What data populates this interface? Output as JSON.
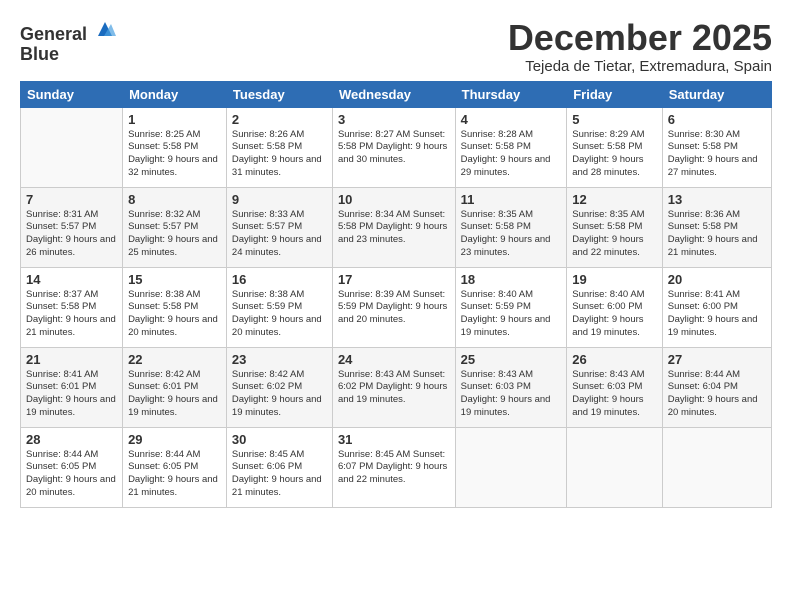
{
  "logo": {
    "line1": "General",
    "line2": "Blue"
  },
  "title": "December 2025",
  "location": "Tejeda de Tietar, Extremadura, Spain",
  "days_header": [
    "Sunday",
    "Monday",
    "Tuesday",
    "Wednesday",
    "Thursday",
    "Friday",
    "Saturday"
  ],
  "weeks": [
    [
      {
        "day": "",
        "info": ""
      },
      {
        "day": "1",
        "info": "Sunrise: 8:25 AM\nSunset: 5:58 PM\nDaylight: 9 hours\nand 32 minutes."
      },
      {
        "day": "2",
        "info": "Sunrise: 8:26 AM\nSunset: 5:58 PM\nDaylight: 9 hours\nand 31 minutes."
      },
      {
        "day": "3",
        "info": "Sunrise: 8:27 AM\nSunset: 5:58 PM\nDaylight: 9 hours\nand 30 minutes."
      },
      {
        "day": "4",
        "info": "Sunrise: 8:28 AM\nSunset: 5:58 PM\nDaylight: 9 hours\nand 29 minutes."
      },
      {
        "day": "5",
        "info": "Sunrise: 8:29 AM\nSunset: 5:58 PM\nDaylight: 9 hours\nand 28 minutes."
      },
      {
        "day": "6",
        "info": "Sunrise: 8:30 AM\nSunset: 5:58 PM\nDaylight: 9 hours\nand 27 minutes."
      }
    ],
    [
      {
        "day": "7",
        "info": "Sunrise: 8:31 AM\nSunset: 5:57 PM\nDaylight: 9 hours\nand 26 minutes."
      },
      {
        "day": "8",
        "info": "Sunrise: 8:32 AM\nSunset: 5:57 PM\nDaylight: 9 hours\nand 25 minutes."
      },
      {
        "day": "9",
        "info": "Sunrise: 8:33 AM\nSunset: 5:57 PM\nDaylight: 9 hours\nand 24 minutes."
      },
      {
        "day": "10",
        "info": "Sunrise: 8:34 AM\nSunset: 5:58 PM\nDaylight: 9 hours\nand 23 minutes."
      },
      {
        "day": "11",
        "info": "Sunrise: 8:35 AM\nSunset: 5:58 PM\nDaylight: 9 hours\nand 23 minutes."
      },
      {
        "day": "12",
        "info": "Sunrise: 8:35 AM\nSunset: 5:58 PM\nDaylight: 9 hours\nand 22 minutes."
      },
      {
        "day": "13",
        "info": "Sunrise: 8:36 AM\nSunset: 5:58 PM\nDaylight: 9 hours\nand 21 minutes."
      }
    ],
    [
      {
        "day": "14",
        "info": "Sunrise: 8:37 AM\nSunset: 5:58 PM\nDaylight: 9 hours\nand 21 minutes."
      },
      {
        "day": "15",
        "info": "Sunrise: 8:38 AM\nSunset: 5:58 PM\nDaylight: 9 hours\nand 20 minutes."
      },
      {
        "day": "16",
        "info": "Sunrise: 8:38 AM\nSunset: 5:59 PM\nDaylight: 9 hours\nand 20 minutes."
      },
      {
        "day": "17",
        "info": "Sunrise: 8:39 AM\nSunset: 5:59 PM\nDaylight: 9 hours\nand 20 minutes."
      },
      {
        "day": "18",
        "info": "Sunrise: 8:40 AM\nSunset: 5:59 PM\nDaylight: 9 hours\nand 19 minutes."
      },
      {
        "day": "19",
        "info": "Sunrise: 8:40 AM\nSunset: 6:00 PM\nDaylight: 9 hours\nand 19 minutes."
      },
      {
        "day": "20",
        "info": "Sunrise: 8:41 AM\nSunset: 6:00 PM\nDaylight: 9 hours\nand 19 minutes."
      }
    ],
    [
      {
        "day": "21",
        "info": "Sunrise: 8:41 AM\nSunset: 6:01 PM\nDaylight: 9 hours\nand 19 minutes."
      },
      {
        "day": "22",
        "info": "Sunrise: 8:42 AM\nSunset: 6:01 PM\nDaylight: 9 hours\nand 19 minutes."
      },
      {
        "day": "23",
        "info": "Sunrise: 8:42 AM\nSunset: 6:02 PM\nDaylight: 9 hours\nand 19 minutes."
      },
      {
        "day": "24",
        "info": "Sunrise: 8:43 AM\nSunset: 6:02 PM\nDaylight: 9 hours\nand 19 minutes."
      },
      {
        "day": "25",
        "info": "Sunrise: 8:43 AM\nSunset: 6:03 PM\nDaylight: 9 hours\nand 19 minutes."
      },
      {
        "day": "26",
        "info": "Sunrise: 8:43 AM\nSunset: 6:03 PM\nDaylight: 9 hours\nand 19 minutes."
      },
      {
        "day": "27",
        "info": "Sunrise: 8:44 AM\nSunset: 6:04 PM\nDaylight: 9 hours\nand 20 minutes."
      }
    ],
    [
      {
        "day": "28",
        "info": "Sunrise: 8:44 AM\nSunset: 6:05 PM\nDaylight: 9 hours\nand 20 minutes."
      },
      {
        "day": "29",
        "info": "Sunrise: 8:44 AM\nSunset: 6:05 PM\nDaylight: 9 hours\nand 21 minutes."
      },
      {
        "day": "30",
        "info": "Sunrise: 8:45 AM\nSunset: 6:06 PM\nDaylight: 9 hours\nand 21 minutes."
      },
      {
        "day": "31",
        "info": "Sunrise: 8:45 AM\nSunset: 6:07 PM\nDaylight: 9 hours\nand 22 minutes."
      },
      {
        "day": "",
        "info": ""
      },
      {
        "day": "",
        "info": ""
      },
      {
        "day": "",
        "info": ""
      }
    ]
  ]
}
